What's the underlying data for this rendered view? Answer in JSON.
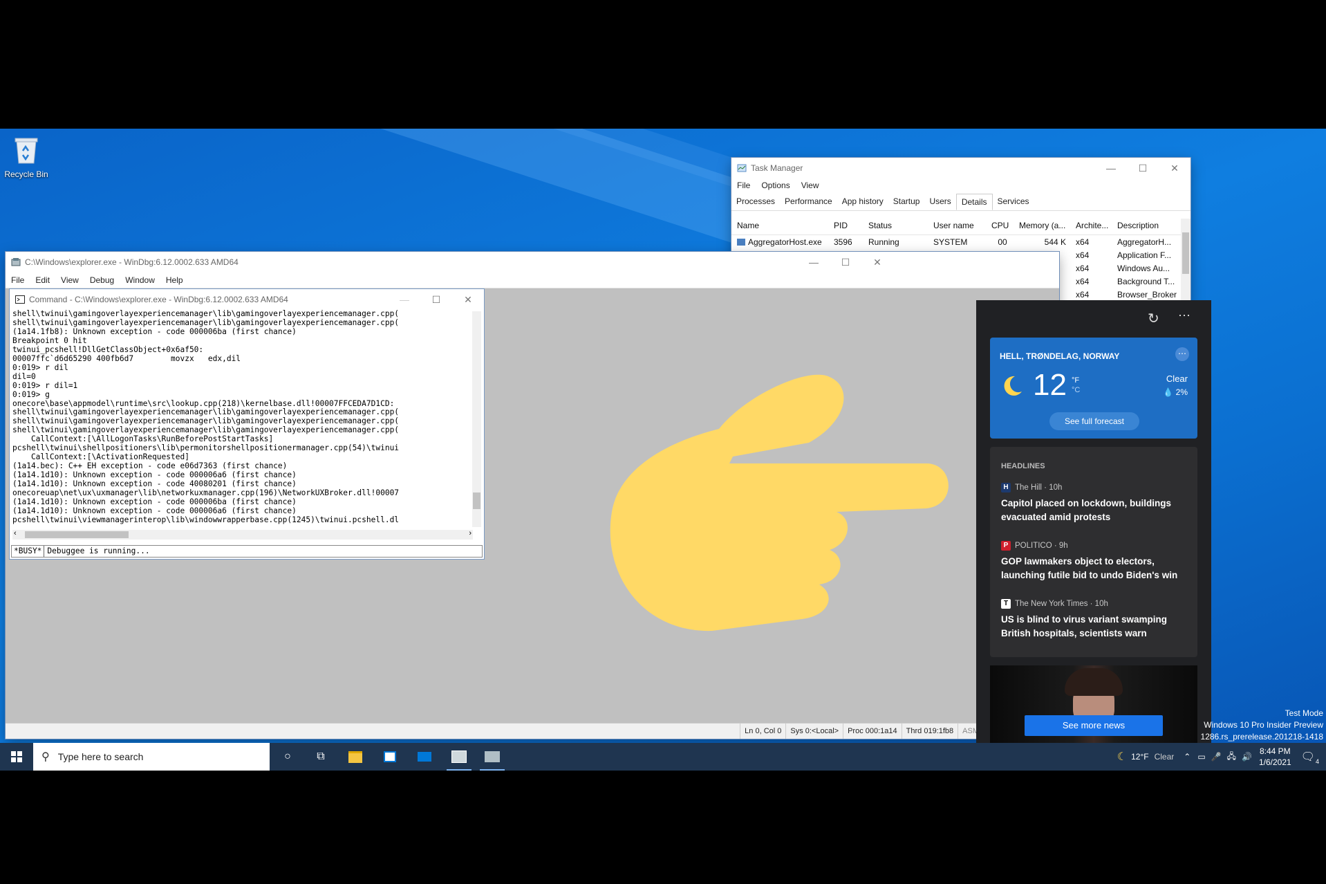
{
  "desktop": {
    "recycle_bin_label": "Recycle Bin"
  },
  "task_manager": {
    "title": "Task Manager",
    "menu": [
      "File",
      "Options",
      "View"
    ],
    "tabs": [
      "Processes",
      "Performance",
      "App history",
      "Startup",
      "Users",
      "Details",
      "Services"
    ],
    "active_tab": "Details",
    "columns": [
      "Name",
      "PID",
      "Status",
      "User name",
      "CPU",
      "Memory (a...",
      "Archite...",
      "Description"
    ],
    "rows": [
      {
        "name": "AggregatorHost.exe",
        "pid": "3596",
        "status": "Running",
        "user": "SYSTEM",
        "cpu": "00",
        "memory": "544 K",
        "arch": "x64",
        "desc": "AggregatorH..."
      },
      {
        "name": "",
        "pid": "",
        "status": "",
        "user": "",
        "cpu": "",
        "memory": "",
        "arch": "x64",
        "desc": "Application F..."
      },
      {
        "name": "",
        "pid": "",
        "status": "",
        "user": "",
        "cpu": "",
        "memory": "",
        "arch": "x64",
        "desc": "Windows Au..."
      },
      {
        "name": "",
        "pid": "",
        "status": "",
        "user": "",
        "cpu": "",
        "memory": "",
        "arch": "x64",
        "desc": "Background T..."
      },
      {
        "name": "",
        "pid": "",
        "status": "",
        "user": "",
        "cpu": "",
        "memory": "",
        "arch": "x64",
        "desc": "Browser_Broker"
      }
    ]
  },
  "windbg": {
    "title": "C:\\Windows\\explorer.exe - WinDbg:6.12.0002.633 AMD64",
    "menu": [
      "File",
      "Edit",
      "View",
      "Debug",
      "Window",
      "Help"
    ],
    "status": [
      "Ln 0, Col 0",
      "Sys 0:<Local>",
      "Proc 000:1a14",
      "Thrd 019:1fb8",
      "ASM"
    ]
  },
  "command_window": {
    "title": "Command - C:\\Windows\\explorer.exe - WinDbg:6.12.0002.633 AMD64",
    "output": [
      "shell\\twinui\\gamingoverlayexperiencemanager\\lib\\gamingoverlayexperiencemanager.cpp(",
      "shell\\twinui\\gamingoverlayexperiencemanager\\lib\\gamingoverlayexperiencemanager.cpp(",
      "(1a14.1fb8): Unknown exception - code 000006ba (first chance)",
      "Breakpoint 0 hit",
      "twinui_pcshell!DllGetClassObject+0x6af50:",
      "00007ffc`d6d65290 400fb6d7        movzx   edx,dil",
      "0:019> r dil",
      "dil=0",
      "0:019> r dil=1",
      "0:019> g",
      "onecore\\base\\appmodel\\runtime\\src\\lookup.cpp(218)\\kernelbase.dll!00007FFCEDA7D1CD:",
      "shell\\twinui\\gamingoverlayexperiencemanager\\lib\\gamingoverlayexperiencemanager.cpp(",
      "shell\\twinui\\gamingoverlayexperiencemanager\\lib\\gamingoverlayexperiencemanager.cpp(",
      "shell\\twinui\\gamingoverlayexperiencemanager\\lib\\gamingoverlayexperiencemanager.cpp(",
      "    CallContext:[\\AllLogonTasks\\RunBeforePostStartTasks]",
      "pcshell\\twinui\\shellpositioners\\lib\\permonitorshellpositionermanager.cpp(54)\\twinui",
      "    CallContext:[\\ActivationRequested]",
      "(1a14.bec): C++ EH exception - code e06d7363 (first chance)",
      "(1a14.1d10): Unknown exception - code 000006a6 (first chance)",
      "(1a14.1d10): Unknown exception - code 40080201 (first chance)",
      "onecoreuap\\net\\ux\\uxmanager\\lib\\networkuxmanager.cpp(196)\\NetworkUXBroker.dll!00007",
      "(1a14.1d10): Unknown exception - code 000006ba (first chance)",
      "(1a14.1d10): Unknown exception - code 000006a6 (first chance)",
      "pcshell\\twinui\\viewmanagerinterop\\lib\\windowwrapperbase.cpp(1245)\\twinui.pcshell.dl"
    ],
    "busy_label": "*BUSY*",
    "input_value": "Debuggee is running..."
  },
  "news": {
    "weather": {
      "location": "HELL, TRØNDELAG, NORWAY",
      "temp": "12",
      "unit_f": "°F",
      "unit_c": "°C",
      "condition": "Clear",
      "precip": "2%",
      "forecast_button": "See full forecast"
    },
    "headlines_label": "HEADLINES",
    "headlines": [
      {
        "source": "The Hill · 10h",
        "title": "Capitol placed on lockdown, buildings evacuated amid protests",
        "icon_color": "#1d3a6e"
      },
      {
        "source": "POLITICO · 9h",
        "title": "GOP lawmakers object to electors, launching futile bid to undo Biden's win",
        "icon_color": "#d01f2d"
      },
      {
        "source": "The New York Times · 10h",
        "title": "US is blind to virus variant swamping British hospitals, scientists warn",
        "icon_color": "#ffffff"
      }
    ],
    "see_more": "See more news"
  },
  "watermark": {
    "line1": "Test Mode",
    "line2": "Windows 10 Pro Insider Preview",
    "line3": "1286.rs_prerelease.201218-1418"
  },
  "taskbar": {
    "search_placeholder": "Type here to search",
    "weather_temp": "12°F",
    "weather_condition": "Clear",
    "time": "8:44 PM",
    "date": "1/6/2021",
    "notification_count": "4"
  },
  "colors": {
    "desktop_blue": "#0b6fd0",
    "hand_yellow": "#ffd966",
    "accent_blue": "#1a73e8"
  }
}
